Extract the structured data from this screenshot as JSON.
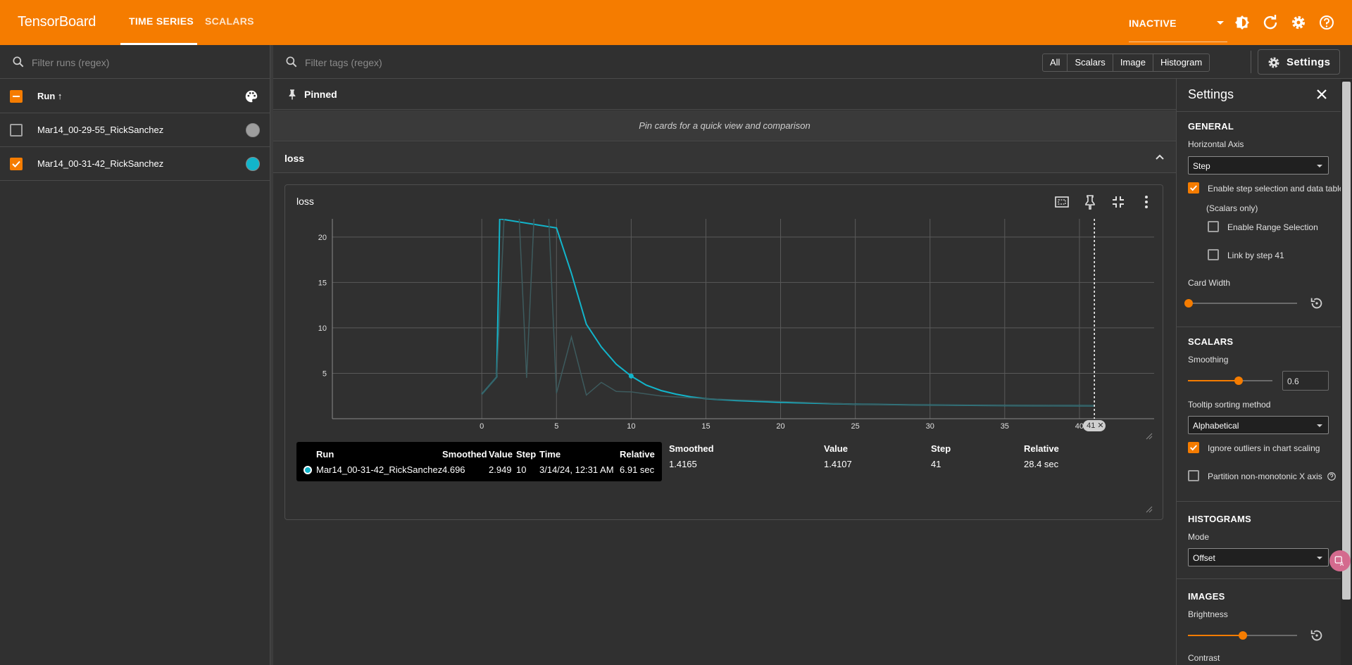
{
  "header": {
    "brand": "TensorBoard",
    "tabs": [
      {
        "label": "TIME SERIES"
      },
      {
        "label": "SCALARS"
      }
    ],
    "status_select": "INACTIVE",
    "icons": [
      "dark-mode-icon",
      "refresh-icon",
      "gear-icon",
      "help-icon"
    ]
  },
  "runs": {
    "filter_placeholder": "Filter runs (regex)",
    "header_label": "Run ↑",
    "items": [
      {
        "label": "Mar14_00-29-55_RickSanchez",
        "checked": false,
        "color": "#9e9e9e"
      },
      {
        "label": "Mar14_00-31-42_RickSanchez",
        "checked": true,
        "color": "#12b5cb"
      }
    ]
  },
  "toolbar": {
    "tags_placeholder": "Filter tags (regex)",
    "types": [
      "All",
      "Scalars",
      "Image",
      "Histogram"
    ],
    "settings_label": "Settings"
  },
  "pinned": {
    "title": "Pinned",
    "message": "Pin cards for a quick view and comparison"
  },
  "group": {
    "title": "loss"
  },
  "card": {
    "title": "loss",
    "step_chip": "41",
    "tooltip": {
      "headers": [
        "Run",
        "Smoothed",
        "Value",
        "Step",
        "Time",
        "Relative"
      ],
      "row": {
        "run": "Mar14_00-31-42_RickSanchez",
        "smoothed": "4.696",
        "value": "2.949",
        "step": "10",
        "time": "3/14/24, 12:31 AM",
        "relative": "6.91 sec"
      }
    },
    "table": {
      "headers": [
        "Smoothed",
        "Value",
        "Step",
        "Relative"
      ],
      "row": {
        "smoothed": "1.4165",
        "value": "1.4107",
        "step": "41",
        "relative": "28.4 sec"
      }
    }
  },
  "chart_data": {
    "type": "line",
    "xlim": [
      -10,
      45
    ],
    "ylim": [
      0,
      22
    ],
    "x_ticks": [
      0,
      5,
      10,
      15,
      20,
      25,
      30,
      35,
      40
    ],
    "y_ticks": [
      5,
      10,
      15,
      20
    ],
    "grid": true,
    "selected_step": 41,
    "series": [
      {
        "role": "smoothed",
        "color": "#12b5cb",
        "x": [
          0,
          1,
          1.2,
          5,
          6,
          7,
          8,
          9,
          10,
          11,
          12,
          13,
          14,
          15,
          17,
          20,
          25,
          30,
          35,
          41
        ],
        "values": [
          2.7,
          4.6,
          22,
          21,
          16,
          10.4,
          7.9,
          6,
          4.696,
          3.7,
          3.1,
          2.7,
          2.4,
          2.2,
          2.0,
          1.8,
          1.6,
          1.5,
          1.45,
          1.4165
        ]
      },
      {
        "role": "raw",
        "color": "#3d5b5e",
        "x": [
          0,
          1,
          2,
          3,
          4,
          5,
          6,
          7,
          8,
          9,
          10,
          12,
          15,
          20,
          25,
          30,
          35,
          41
        ],
        "values": [
          2.7,
          4.6,
          40,
          4.5,
          40,
          2.8,
          9,
          2.6,
          4,
          3.0,
          2.949,
          2.5,
          2.2,
          1.9,
          1.6,
          1.5,
          1.45,
          1.4107
        ]
      }
    ],
    "tooltip_point": {
      "x": 10,
      "y": 4.696
    }
  },
  "settings": {
    "title": "Settings",
    "general": {
      "title": "GENERAL",
      "h_axis_label": "Horizontal Axis",
      "h_axis_value": "Step",
      "step_selection_label": "Enable step selection and data table",
      "scalars_only": "(Scalars only)",
      "range_selection_label": "Enable Range Selection",
      "link_step_label": "Link by step 41",
      "card_width_label": "Card Width"
    },
    "scalars": {
      "title": "SCALARS",
      "smoothing_label": "Smoothing",
      "smoothing_value": "0.6",
      "smoothing_fraction": 0.6,
      "tooltip_sort_label": "Tooltip sorting method",
      "tooltip_sort_value": "Alphabetical",
      "ignore_outliers_label": "Ignore outliers in chart scaling",
      "partition_label": "Partition non-monotonic X axis"
    },
    "histograms": {
      "title": "HISTOGRAMS",
      "mode_label": "Mode",
      "mode_value": "Offset"
    },
    "images": {
      "title": "IMAGES",
      "brightness_label": "Brightness",
      "contrast_label": "Contrast"
    }
  }
}
